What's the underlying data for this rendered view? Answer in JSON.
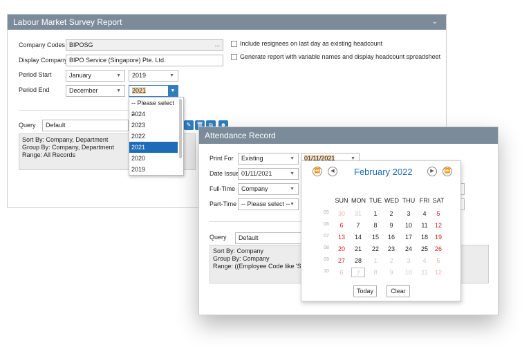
{
  "main_panel": {
    "title": "Labour Market Survey Report",
    "company_codes_label": "Company Codes",
    "company_codes_value": "BIPOSG",
    "display_company_label": "Display Company",
    "display_company_value": "BIPO Service (Singapore) Pte. Ltd.",
    "period_start_label": "Period Start",
    "period_start_month": "January",
    "period_start_year": "2019",
    "period_end_label": "Period End",
    "period_end_month": "December",
    "period_end_year": "2021",
    "include_resignees_label": "Include resignees on last day as existing headcount",
    "generate_variable_label": "Generate report with variable names and display headcount spreadsheet",
    "query_label": "Query",
    "query_value": "Default",
    "query_info": [
      "Sort By: Company, Department",
      "Group By: Company, Department",
      "Range: All Records"
    ]
  },
  "year_dropdown": {
    "items": [
      "-- Please select --",
      "2024",
      "2023",
      "2022",
      "2021",
      "2020",
      "2019"
    ],
    "selected": "2021"
  },
  "attendance": {
    "title": "Attendance Record",
    "print_for_label": "Print For",
    "print_for_value": "Existing",
    "print_date": "01/11/2021",
    "date_issue_label": "Date Issue",
    "date_issue_value": "01/11/2021",
    "full_time_label": "Full-Time",
    "full_time_value": "Company",
    "part_time_label": "Part-Time",
    "part_time_value": "-- Please select --",
    "query_label": "Query",
    "query_value": "Default",
    "query_info": [
      "Sort By: Company",
      "Group By: Company",
      "Range: ((Employee Code like 'SG%'"
    ]
  },
  "calendar": {
    "month_title": "February 2022",
    "days_of_week": [
      "SUN",
      "MON",
      "TUE",
      "WED",
      "THU",
      "FRI",
      "SAT"
    ],
    "weeks": [
      {
        "wk": "05",
        "days": [
          "30",
          "31",
          "1",
          "2",
          "3",
          "4",
          "5"
        ]
      },
      {
        "wk": "06",
        "days": [
          "6",
          "7",
          "8",
          "9",
          "10",
          "11",
          "12"
        ]
      },
      {
        "wk": "07",
        "days": [
          "13",
          "14",
          "15",
          "16",
          "17",
          "18",
          "19"
        ]
      },
      {
        "wk": "08",
        "days": [
          "20",
          "21",
          "22",
          "23",
          "24",
          "25",
          "26"
        ]
      },
      {
        "wk": "09",
        "days": [
          "27",
          "28",
          "1",
          "2",
          "3",
          "4",
          "5"
        ]
      },
      {
        "wk": "10",
        "days": [
          "6",
          "7",
          "8",
          "9",
          "10",
          "11",
          "12"
        ]
      }
    ],
    "today_label": "Today",
    "clear_label": "Clear"
  }
}
